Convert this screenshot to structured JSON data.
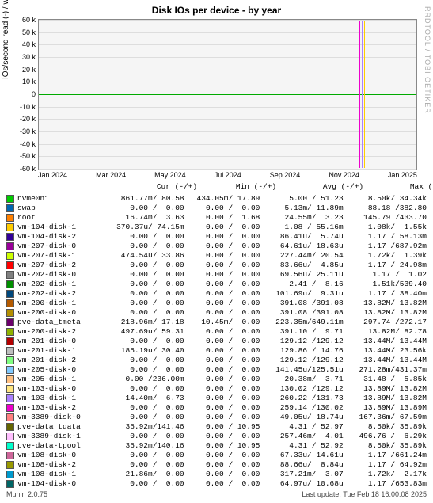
{
  "chart_data": {
    "type": "line",
    "title": "Disk IOs per device - by year",
    "ylabel": "IOs/second read (-) / write (+)",
    "ylim": [
      -60000,
      60000
    ],
    "y_ticks": [
      "60 k",
      "50 k",
      "40 k",
      "30 k",
      "20 k",
      "10 k",
      "0",
      "-10 k",
      "-20 k",
      "-30 k",
      "-40 k",
      "-50 k",
      "-60 k"
    ],
    "x_ticks": [
      "Jan 2024",
      "Mar 2024",
      "May 2024",
      "Jul 2024",
      "Sep 2024",
      "Nov 2024",
      "Jan 2025"
    ],
    "watermark": "RRDTOOL / TOBI OETIKER",
    "columns": [
      "Cur (-/+)",
      "Min (-/+)",
      "Avg (-/+)",
      "Max (-/+)"
    ],
    "series": [
      {
        "name": "nvme0n1",
        "color": "#00cc00",
        "cur": "861.77m/ 80.58",
        "min": "434.05m/ 17.89",
        "avg": "5.00 / 51.23",
        "max": "8.50k/ 34.34k"
      },
      {
        "name": "swap",
        "color": "#0066b3",
        "cur": "0.00 /  0.00",
        "min": "0.00 /  0.00",
        "avg": "5.13m/ 11.89m",
        "max": "88.18 /382.80"
      },
      {
        "name": "root",
        "color": "#ff8000",
        "cur": "16.74m/  3.63",
        "min": "0.00 /  1.68",
        "avg": "24.55m/  3.23",
        "max": "145.79 /433.70"
      },
      {
        "name": "vm-104-disk-1",
        "color": "#ffcc00",
        "cur": "370.37u/ 74.15m",
        "min": "0.00 /  0.00",
        "avg": "1.08 / 55.16m",
        "max": "1.08k/  1.55k"
      },
      {
        "name": "vm-104-disk-2",
        "color": "#330099",
        "cur": "0.00 /  0.00",
        "min": "0.00 /  0.00",
        "avg": "86.41u/  5.74u",
        "max": "1.17 / 58.13m"
      },
      {
        "name": "vm-207-disk-0",
        "color": "#990099",
        "cur": "0.00 /  0.00",
        "min": "0.00 /  0.00",
        "avg": "64.61u/ 18.63u",
        "max": "1.17 /687.92m"
      },
      {
        "name": "vm-207-disk-1",
        "color": "#ccff00",
        "cur": "474.54u/ 33.86",
        "min": "0.00 /  0.00",
        "avg": "227.44m/ 20.54",
        "max": "1.72k/  1.39k"
      },
      {
        "name": "vm-207-disk-2",
        "color": "#ff0000",
        "cur": "0.00 /  0.00",
        "min": "0.00 /  0.00",
        "avg": "83.66u/  4.85u",
        "max": "1.17 / 24.98m"
      },
      {
        "name": "vm-202-disk-0",
        "color": "#808080",
        "cur": "0.00 /  0.00",
        "min": "0.00 /  0.00",
        "avg": "69.56u/ 25.11u",
        "max": "1.17 /  1.02"
      },
      {
        "name": "vm-202-disk-1",
        "color": "#008f00",
        "cur": "0.00 /  0.00",
        "min": "0.00 /  0.00",
        "avg": "2.41 /  8.16",
        "max": "1.51k/539.40"
      },
      {
        "name": "vm-202-disk-2",
        "color": "#00487d",
        "cur": "0.00 /  0.00",
        "min": "0.00 /  0.00",
        "avg": "101.69u/  9.31u",
        "max": "1.17 / 38.40m"
      },
      {
        "name": "vm-200-disk-1",
        "color": "#b35a00",
        "cur": "0.00 /  0.00",
        "min": "0.00 /  0.00",
        "avg": "391.08 /391.08",
        "max": "13.82M/ 13.82M"
      },
      {
        "name": "vm-200-disk-0",
        "color": "#b38f00",
        "cur": "0.00 /  0.00",
        "min": "0.00 /  0.00",
        "avg": "391.08 /391.08",
        "max": "13.82M/ 13.82M"
      },
      {
        "name": "pve-data_tmeta",
        "color": "#6b006b",
        "cur": "218.96m/ 17.18",
        "min": "10.45m/  0.00",
        "avg": "223.35m/649.11m",
        "max": "297.74 /272.17"
      },
      {
        "name": "vm-200-disk-2",
        "color": "#8fb300",
        "cur": "497.69u/ 59.31",
        "min": "0.00 /  0.00",
        "avg": "391.10 /  9.71",
        "max": "13.82M/ 82.78"
      },
      {
        "name": "vm-201-disk-0",
        "color": "#b30000",
        "cur": "0.00 /  0.00",
        "min": "0.00 /  0.00",
        "avg": "129.12 /129.12",
        "max": "13.44M/ 13.44M"
      },
      {
        "name": "vm-201-disk-1",
        "color": "#bebebe",
        "cur": "185.19u/ 30.40",
        "min": "0.00 /  0.00",
        "avg": "129.86 / 14.76",
        "max": "13.44M/ 23.56k"
      },
      {
        "name": "vm-201-disk-2",
        "color": "#80ff80",
        "cur": "0.00 /  0.00",
        "min": "0.00 /  0.00",
        "avg": "129.12 /129.12",
        "max": "13.44M/ 13.44M"
      },
      {
        "name": "vm-205-disk-0",
        "color": "#80c9ff",
        "cur": "0.00 /  0.00",
        "min": "0.00 /  0.00",
        "avg": "141.45u/125.51u",
        "max": "271.28m/431.37m"
      },
      {
        "name": "vm-205-disk-1",
        "color": "#ffc080",
        "cur": "0.00 /236.00m",
        "min": "0.00 /  0.00",
        "avg": "20.38m/  3.71",
        "max": "31.48 /  5.85k"
      },
      {
        "name": "vm-103-disk-0",
        "color": "#ffe680",
        "cur": "0.00 /  0.00",
        "min": "0.00 /  0.00",
        "avg": "130.02 /129.12",
        "max": "13.89M/ 13.82M"
      },
      {
        "name": "vm-103-disk-1",
        "color": "#aa80ff",
        "cur": "14.40m/  6.73",
        "min": "0.00 /  0.00",
        "avg": "260.22 /131.73",
        "max": "13.89M/ 13.82M"
      },
      {
        "name": "vm-103-disk-2",
        "color": "#ee00cc",
        "cur": "0.00 /  0.00",
        "min": "0.00 /  0.00",
        "avg": "259.14 /130.02",
        "max": "13.89M/ 13.89M"
      },
      {
        "name": "vm-3389-disk-0",
        "color": "#ff8080",
        "cur": "0.00 /  0.00",
        "min": "0.00 /  0.00",
        "avg": "49.05u/ 18.74u",
        "max": "167.36m/ 67.59m"
      },
      {
        "name": "pve-data_tdata",
        "color": "#666600",
        "cur": "36.92m/141.46",
        "min": "0.00 / 10.95",
        "avg": "4.31 / 52.97",
        "max": "8.50k/ 35.89k"
      },
      {
        "name": "vm-3389-disk-1",
        "color": "#ffbfff",
        "cur": "0.00 /  0.00",
        "min": "0.00 /  0.00",
        "avg": "257.46m/  4.01",
        "max": "496.76 /  6.29k"
      },
      {
        "name": "pve-data-tpool",
        "color": "#00ffcc",
        "cur": "36.92m/140.16",
        "min": "0.00 / 10.95",
        "avg": "4.31 / 52.92",
        "max": "8.50k/ 35.89k"
      },
      {
        "name": "vm-108-disk-0",
        "color": "#cc6699",
        "cur": "0.00 /  0.00",
        "min": "0.00 /  0.00",
        "avg": "67.33u/ 14.61u",
        "max": "1.17 /661.24m"
      },
      {
        "name": "vm-108-disk-2",
        "color": "#999900",
        "cur": "0.00 /  0.00",
        "min": "0.00 /  0.00",
        "avg": "88.66u/  8.84u",
        "max": "1.17 / 64.92m"
      },
      {
        "name": "vm-108-disk-1",
        "color": "#0099cc",
        "cur": "21.86m/  0.00",
        "min": "0.00 /  0.00",
        "avg": "317.21m/  3.07",
        "max": "1.72k/  2.17k"
      },
      {
        "name": "vm-104-disk-0",
        "color": "#006666",
        "cur": "0.00 /  0.00",
        "min": "0.00 /  0.00",
        "avg": "64.97u/ 10.68u",
        "max": "1.17 /653.83m"
      }
    ]
  },
  "footer": {
    "last_update": "Last update: Tue Feb 18 16:00:08 2025",
    "generator": "Munin 2.0.75"
  }
}
